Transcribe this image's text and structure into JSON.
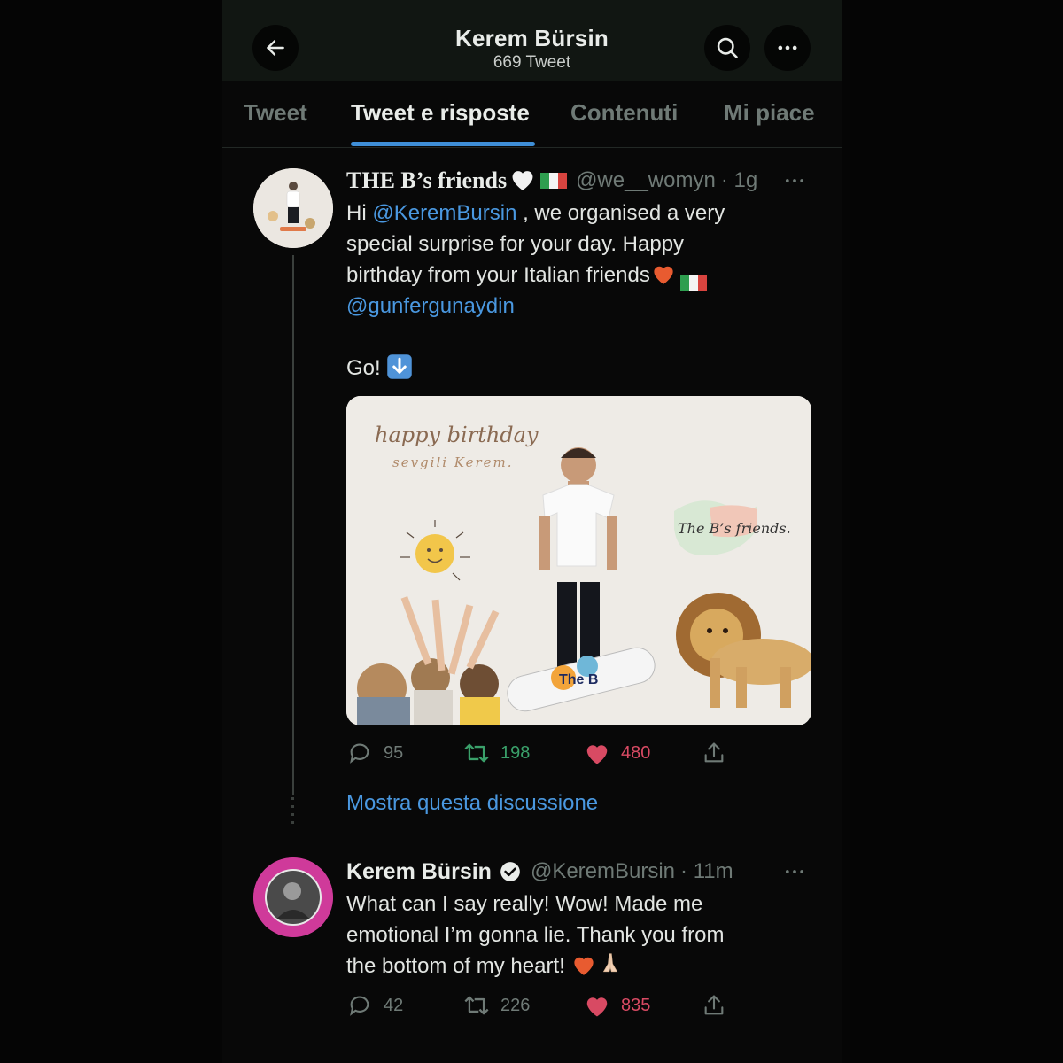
{
  "header": {
    "title": "Kerem Bürsin",
    "subtitle": "669 Tweet",
    "icons": [
      "arrow-left-icon",
      "search-icon",
      "more-icon"
    ]
  },
  "tabs": [
    {
      "label": "Tweet",
      "active": false
    },
    {
      "label": "Tweet e risposte",
      "active": true
    },
    {
      "label": "Contenuti",
      "active": false
    },
    {
      "label": "Mi piace",
      "active": false
    }
  ],
  "tweets": [
    {
      "name": "THE B’s friends",
      "handle": "@we__womyn",
      "time": "· 1g",
      "text": {
        "hi": "Hi",
        "mention1": "@KeremBursin",
        "line1": ", we organised a very",
        "line2": "special surprise for your day. Happy",
        "line3": "birthday from your Italian friends",
        "mention2": "@gunfergunaydin",
        "go": "Go!"
      },
      "image": {
        "title_line1": "happy birthday",
        "title_line2": "sevgili Kerem.",
        "logo": "The B’s friends.",
        "skate": "The B"
      },
      "stats": {
        "replies": "95",
        "retweets": "198",
        "likes": "480"
      }
    },
    {
      "name": "Kerem Bürsin",
      "handle": "@KeremBursin",
      "time": "· 11m",
      "verified": true,
      "text": {
        "line1": "What can I say really! Wow! Made me",
        "line2": "emotional I’m gonna lie. Thank you from",
        "line3": "the bottom of my heart!"
      },
      "stats": {
        "replies": "42",
        "retweets": "226",
        "likes": "835"
      }
    }
  ],
  "show_thread": "Mostra questa discussione",
  "colors": {
    "accent": "#4a98e0",
    "retweet": "#3aa06a",
    "like": "#d84a63",
    "muted": "#6f7a76"
  }
}
